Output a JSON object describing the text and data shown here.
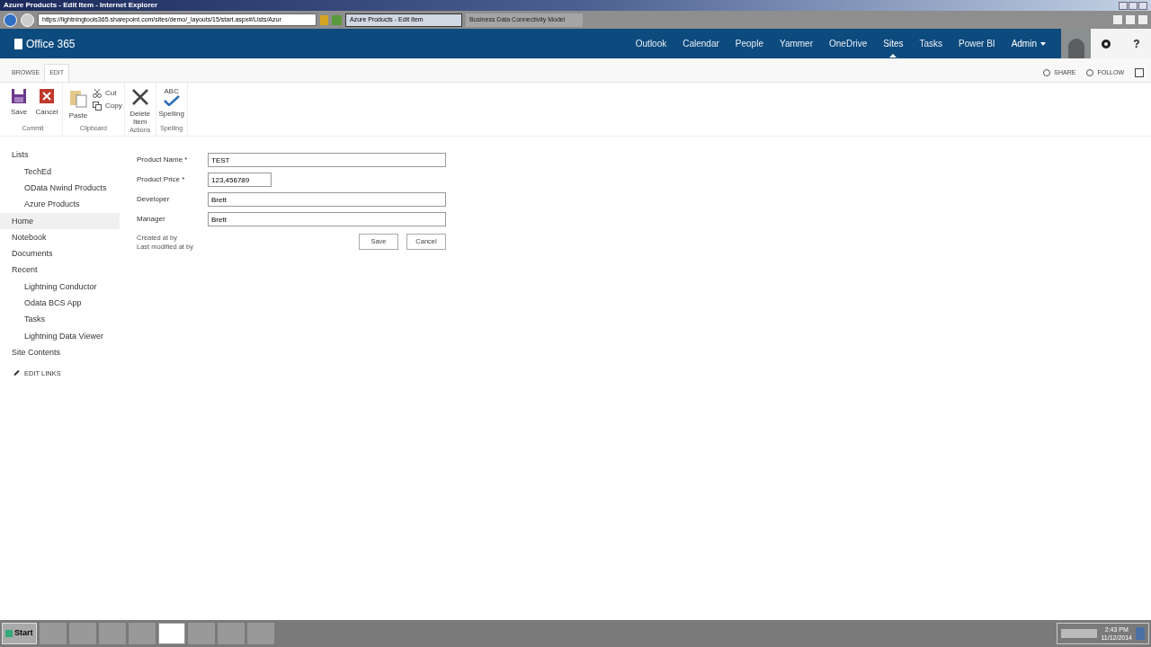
{
  "window": {
    "title": "Azure Products - Edit Item - Internet Explorer"
  },
  "browser": {
    "address": "https://lightningtools365.sharepoint.com/sites/demo/_layouts/15/start.aspx#/Lists/Azur",
    "tabs": [
      {
        "label": "Azure Products - Edit Item",
        "selected": true
      },
      {
        "label": "Business Data Connectivity Model",
        "selected": false
      }
    ]
  },
  "suite_bar": {
    "brand": "Office 365",
    "links": [
      {
        "label": "Outlook",
        "selected": false
      },
      {
        "label": "Calendar",
        "selected": false
      },
      {
        "label": "People",
        "selected": false
      },
      {
        "label": "Yammer",
        "selected": false
      },
      {
        "label": "OneDrive",
        "selected": false
      },
      {
        "label": "Sites",
        "selected": true
      },
      {
        "label": "Tasks",
        "selected": false
      },
      {
        "label": "Power BI",
        "selected": false
      }
    ],
    "admin": "Admin",
    "help": "?"
  },
  "ribbon": {
    "tabs": [
      {
        "label": "BROWSE",
        "selected": false
      },
      {
        "label": "EDIT",
        "selected": true
      }
    ],
    "actions": [
      "SHARE",
      "FOLLOW"
    ],
    "groups": [
      {
        "label": "Commit",
        "commands": [
          {
            "kind": "save",
            "label": "Save"
          },
          {
            "kind": "cancel",
            "label": "Cancel"
          }
        ]
      },
      {
        "label": "Clipboard",
        "commands": [
          {
            "kind": "paste",
            "label": "Paste"
          },
          {
            "kind": "cut",
            "label": "Cut"
          },
          {
            "kind": "copy",
            "label": "Copy"
          }
        ]
      },
      {
        "label": "Actions",
        "commands": [
          {
            "kind": "delete",
            "label": "Delete Item"
          }
        ]
      },
      {
        "label": "Spelling",
        "commands": [
          {
            "kind": "spelling",
            "label": "Spelling",
            "badge": "ABC"
          }
        ]
      }
    ]
  },
  "nav": {
    "items": [
      {
        "label": "Lists",
        "selected": false,
        "children": [
          {
            "label": "TechEd",
            "selected": false
          },
          {
            "label": "OData Nwind Products",
            "selected": false
          },
          {
            "label": "Azure Products",
            "selected": false
          }
        ]
      },
      {
        "label": "Home",
        "selected": true
      },
      {
        "label": "Notebook",
        "selected": false
      },
      {
        "label": "Documents",
        "selected": false
      },
      {
        "label": "Recent",
        "selected": false,
        "children": [
          {
            "label": "Lightning Conductor",
            "selected": false
          },
          {
            "label": "Odata BCS App",
            "selected": false
          },
          {
            "label": "Tasks",
            "selected": false
          },
          {
            "label": "Lightning Data Viewer",
            "selected": false
          }
        ]
      },
      {
        "label": "Site Contents",
        "selected": false
      }
    ],
    "edit_links": "EDIT LINKS"
  },
  "form": {
    "fields": [
      {
        "label": "Product Name *",
        "value": "TEST",
        "kind": "wide"
      },
      {
        "label": "Product Price *",
        "value": "123,456789",
        "kind": "narrow"
      },
      {
        "label": "Developer",
        "value": "Brett",
        "kind": "wide"
      },
      {
        "label": "Manager",
        "value": "Brett",
        "kind": "wide"
      }
    ],
    "meta": [
      "Created at by",
      "Last modified at by"
    ],
    "buttons": [
      "Save",
      "Cancel"
    ]
  },
  "taskbar": {
    "start": "Start",
    "time": "2:43 PM",
    "date": "11/12/2014"
  }
}
